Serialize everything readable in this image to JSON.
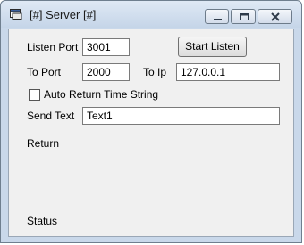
{
  "window": {
    "title": "[#] Server [#]",
    "icons": {
      "app": "window-app-icon",
      "minimize": "minimize-icon",
      "maximize": "maximize-icon",
      "close": "close-icon"
    }
  },
  "form": {
    "listen_port": {
      "label": "Listen Port",
      "value": "3001"
    },
    "start_listen_button": "Start Listen",
    "to_port": {
      "label": "To Port",
      "value": "2000"
    },
    "to_ip": {
      "label": "To Ip",
      "value": "127.0.0.1"
    },
    "auto_return": {
      "label": "Auto Return Time String",
      "checked": false
    },
    "send_text": {
      "label": "Send Text",
      "value": "Text1"
    },
    "return_label": "Return",
    "status_label": "Status"
  }
}
